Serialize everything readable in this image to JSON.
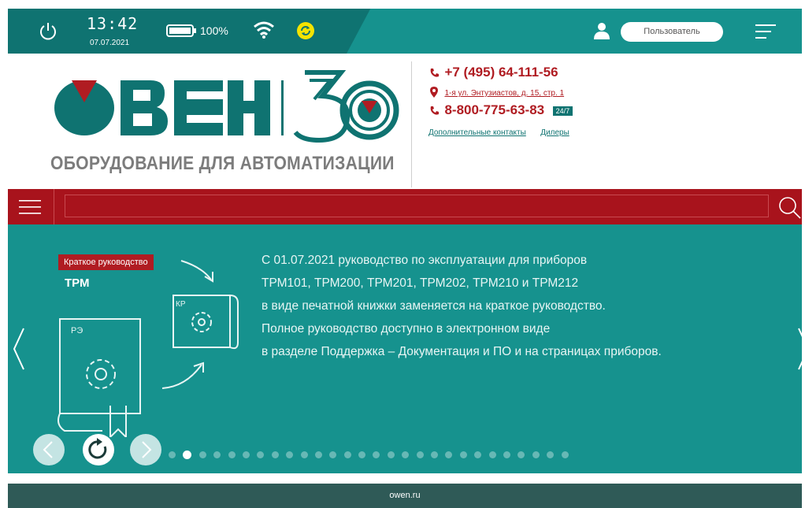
{
  "status_bar": {
    "time": "13:42",
    "date": "07.07.2021",
    "battery": "100%",
    "user_button": "Пользователь",
    "icons": [
      "power-icon",
      "battery-icon",
      "wifi-icon",
      "sync-icon",
      "user-icon",
      "menu-icon"
    ]
  },
  "header": {
    "logo_text": "ОВЕН",
    "anniversary": "30",
    "tagline": "ОБОРУДОВАНИЕ ДЛЯ АВТОМАТИЗАЦИИ",
    "phone1": "+7 (495) 64-111-56",
    "address": "1-я ул. Энтузиастов, д. 15, стр. 1",
    "phone2": "8-800-775-63-83",
    "badge": "24/7",
    "link_contacts": "Дополнительные контакты",
    "link_dealers": "Дилеры"
  },
  "search": {
    "value": "",
    "placeholder": ""
  },
  "banner": {
    "tag": "Краткое руководство",
    "product": "ТРМ",
    "doc_label_1": "РЭ",
    "doc_label_2": "КР",
    "lines": [
      "С 01.07.2021 руководство по эксплуатации для приборов",
      "ТРМ101, ТРМ200, ТРМ201, ТРМ202, ТРМ210 и ТРМ212",
      "в виде печатной книжки заменяется на краткое руководство.",
      "Полное руководство доступно в электронном виде",
      "в разделе Поддержка – Документация и ПО и на страницах приборов."
    ],
    "slide_count": 28,
    "active_slide": 2
  },
  "footer": {
    "url": "owen.ru"
  },
  "colors": {
    "teal_dark": "#0f7371",
    "teal": "#16928e",
    "red": "#a8131c",
    "footer": "#2f5a57"
  }
}
